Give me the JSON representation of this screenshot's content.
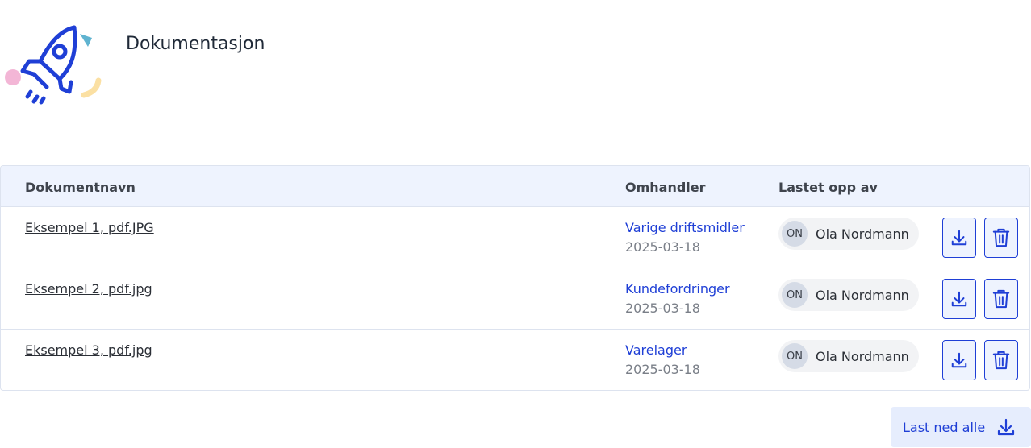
{
  "page": {
    "title": "Dokumentasjon"
  },
  "colors": {
    "accent": "#1f3fd6",
    "header_bg": "#eef3fe",
    "border": "#dde3ef"
  },
  "table": {
    "headers": {
      "name": "Dokumentnavn",
      "topic": "Omhandler",
      "uploaded_by": "Lastet opp av"
    },
    "rows": [
      {
        "name": "Eksempel 1, pdf.JPG",
        "topic": "Varige driftsmidler",
        "date": "2025-03-18",
        "initials": "ON",
        "user": "Ola Nordmann"
      },
      {
        "name": "Eksempel 2, pdf.jpg",
        "topic": "Kundefordringer",
        "date": "2025-03-18",
        "initials": "ON",
        "user": "Ola Nordmann"
      },
      {
        "name": "Eksempel 3, pdf.jpg",
        "topic": "Varelager",
        "date": "2025-03-18",
        "initials": "ON",
        "user": "Ola Nordmann"
      }
    ],
    "row_icons": {
      "download": "download-icon",
      "delete": "trash-icon"
    }
  },
  "footer": {
    "download_all_label": "Last ned alle",
    "download_all_icon": "download-icon"
  },
  "logo": {
    "icon": "rocket-icon"
  }
}
